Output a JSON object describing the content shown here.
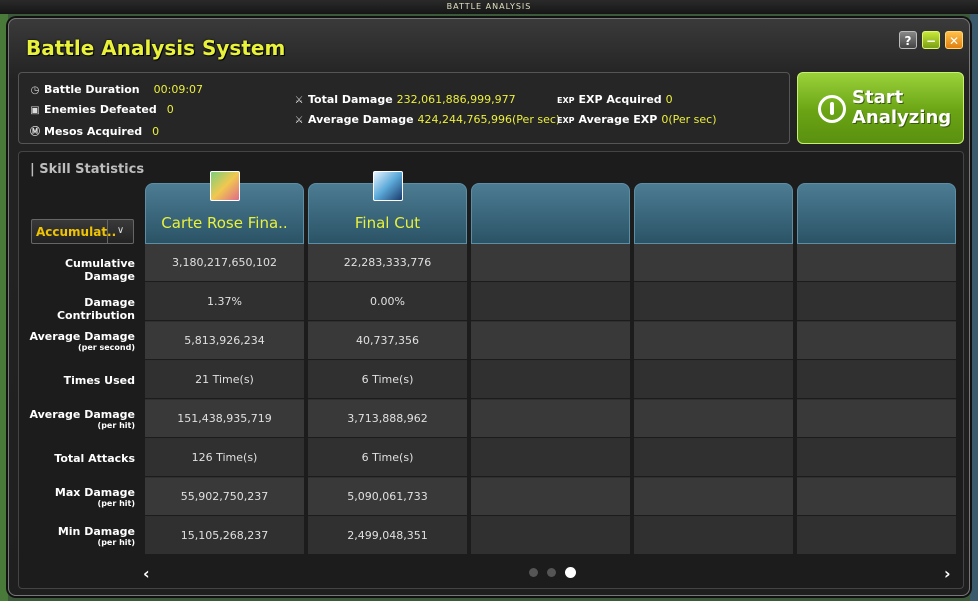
{
  "top_strip_title": "BATTLE ANALYSIS",
  "window": {
    "title": "Battle Analysis System",
    "help_label": "?",
    "minimize_label": "−",
    "close_label": "✕"
  },
  "summary": {
    "battle_duration_label": "Battle Duration",
    "battle_duration_value": "00:09:07",
    "enemies_defeated_label": "Enemies Defeated",
    "enemies_defeated_value": "0",
    "mesos_acquired_label": "Mesos Acquired",
    "mesos_acquired_value": "0",
    "total_damage_label": "Total Damage",
    "total_damage_value": "232,061,886,999,977",
    "average_damage_label": "Average Damage",
    "average_damage_value": "424,244,765,996(Per sec)",
    "exp_tag": "EXP",
    "exp_acquired_label": "EXP Acquired",
    "exp_acquired_value": "0",
    "average_exp_label": "Average EXP",
    "average_exp_value": "0(Per sec)"
  },
  "start_button": {
    "line1": "Start",
    "line2": "Analyzing"
  },
  "skill_stats": {
    "section_title": "Skill Statistics",
    "dropdown_value": "Accumulat..",
    "rows": [
      {
        "label": "Cumulative Damage",
        "sub": ""
      },
      {
        "label": "Damage Contribution",
        "sub": ""
      },
      {
        "label": "Average Damage",
        "sub": "(per second)"
      },
      {
        "label": "Times Used",
        "sub": ""
      },
      {
        "label": "Average Damage",
        "sub": "(per hit)"
      },
      {
        "label": "Total Attacks",
        "sub": ""
      },
      {
        "label": "Max Damage",
        "sub": "(per hit)"
      },
      {
        "label": "Min Damage",
        "sub": "(per hit)"
      }
    ],
    "skills": [
      {
        "name": "Carte Rose Fina..",
        "icon": "carte-rose-icon",
        "values": [
          "3,180,217,650,102",
          "1.37%",
          "5,813,926,234",
          "21 Time(s)",
          "151,438,935,719",
          "126 Time(s)",
          "55,902,750,237",
          "15,105,268,237"
        ]
      },
      {
        "name": "Final Cut",
        "icon": "final-cut-icon",
        "values": [
          "22,283,333,776",
          "0.00%",
          "40,737,356",
          "6 Time(s)",
          "3,713,888,962",
          "6 Time(s)",
          "5,090,061,733",
          "2,499,048,351"
        ]
      }
    ]
  },
  "pagination": {
    "pages": 3,
    "current_page": 3,
    "prev_icon": "‹",
    "next_icon": "›"
  },
  "colors": {
    "accent_yellow": "#e9f23a",
    "header_teal": "#3e6b80",
    "button_green": "#7ab41e"
  }
}
